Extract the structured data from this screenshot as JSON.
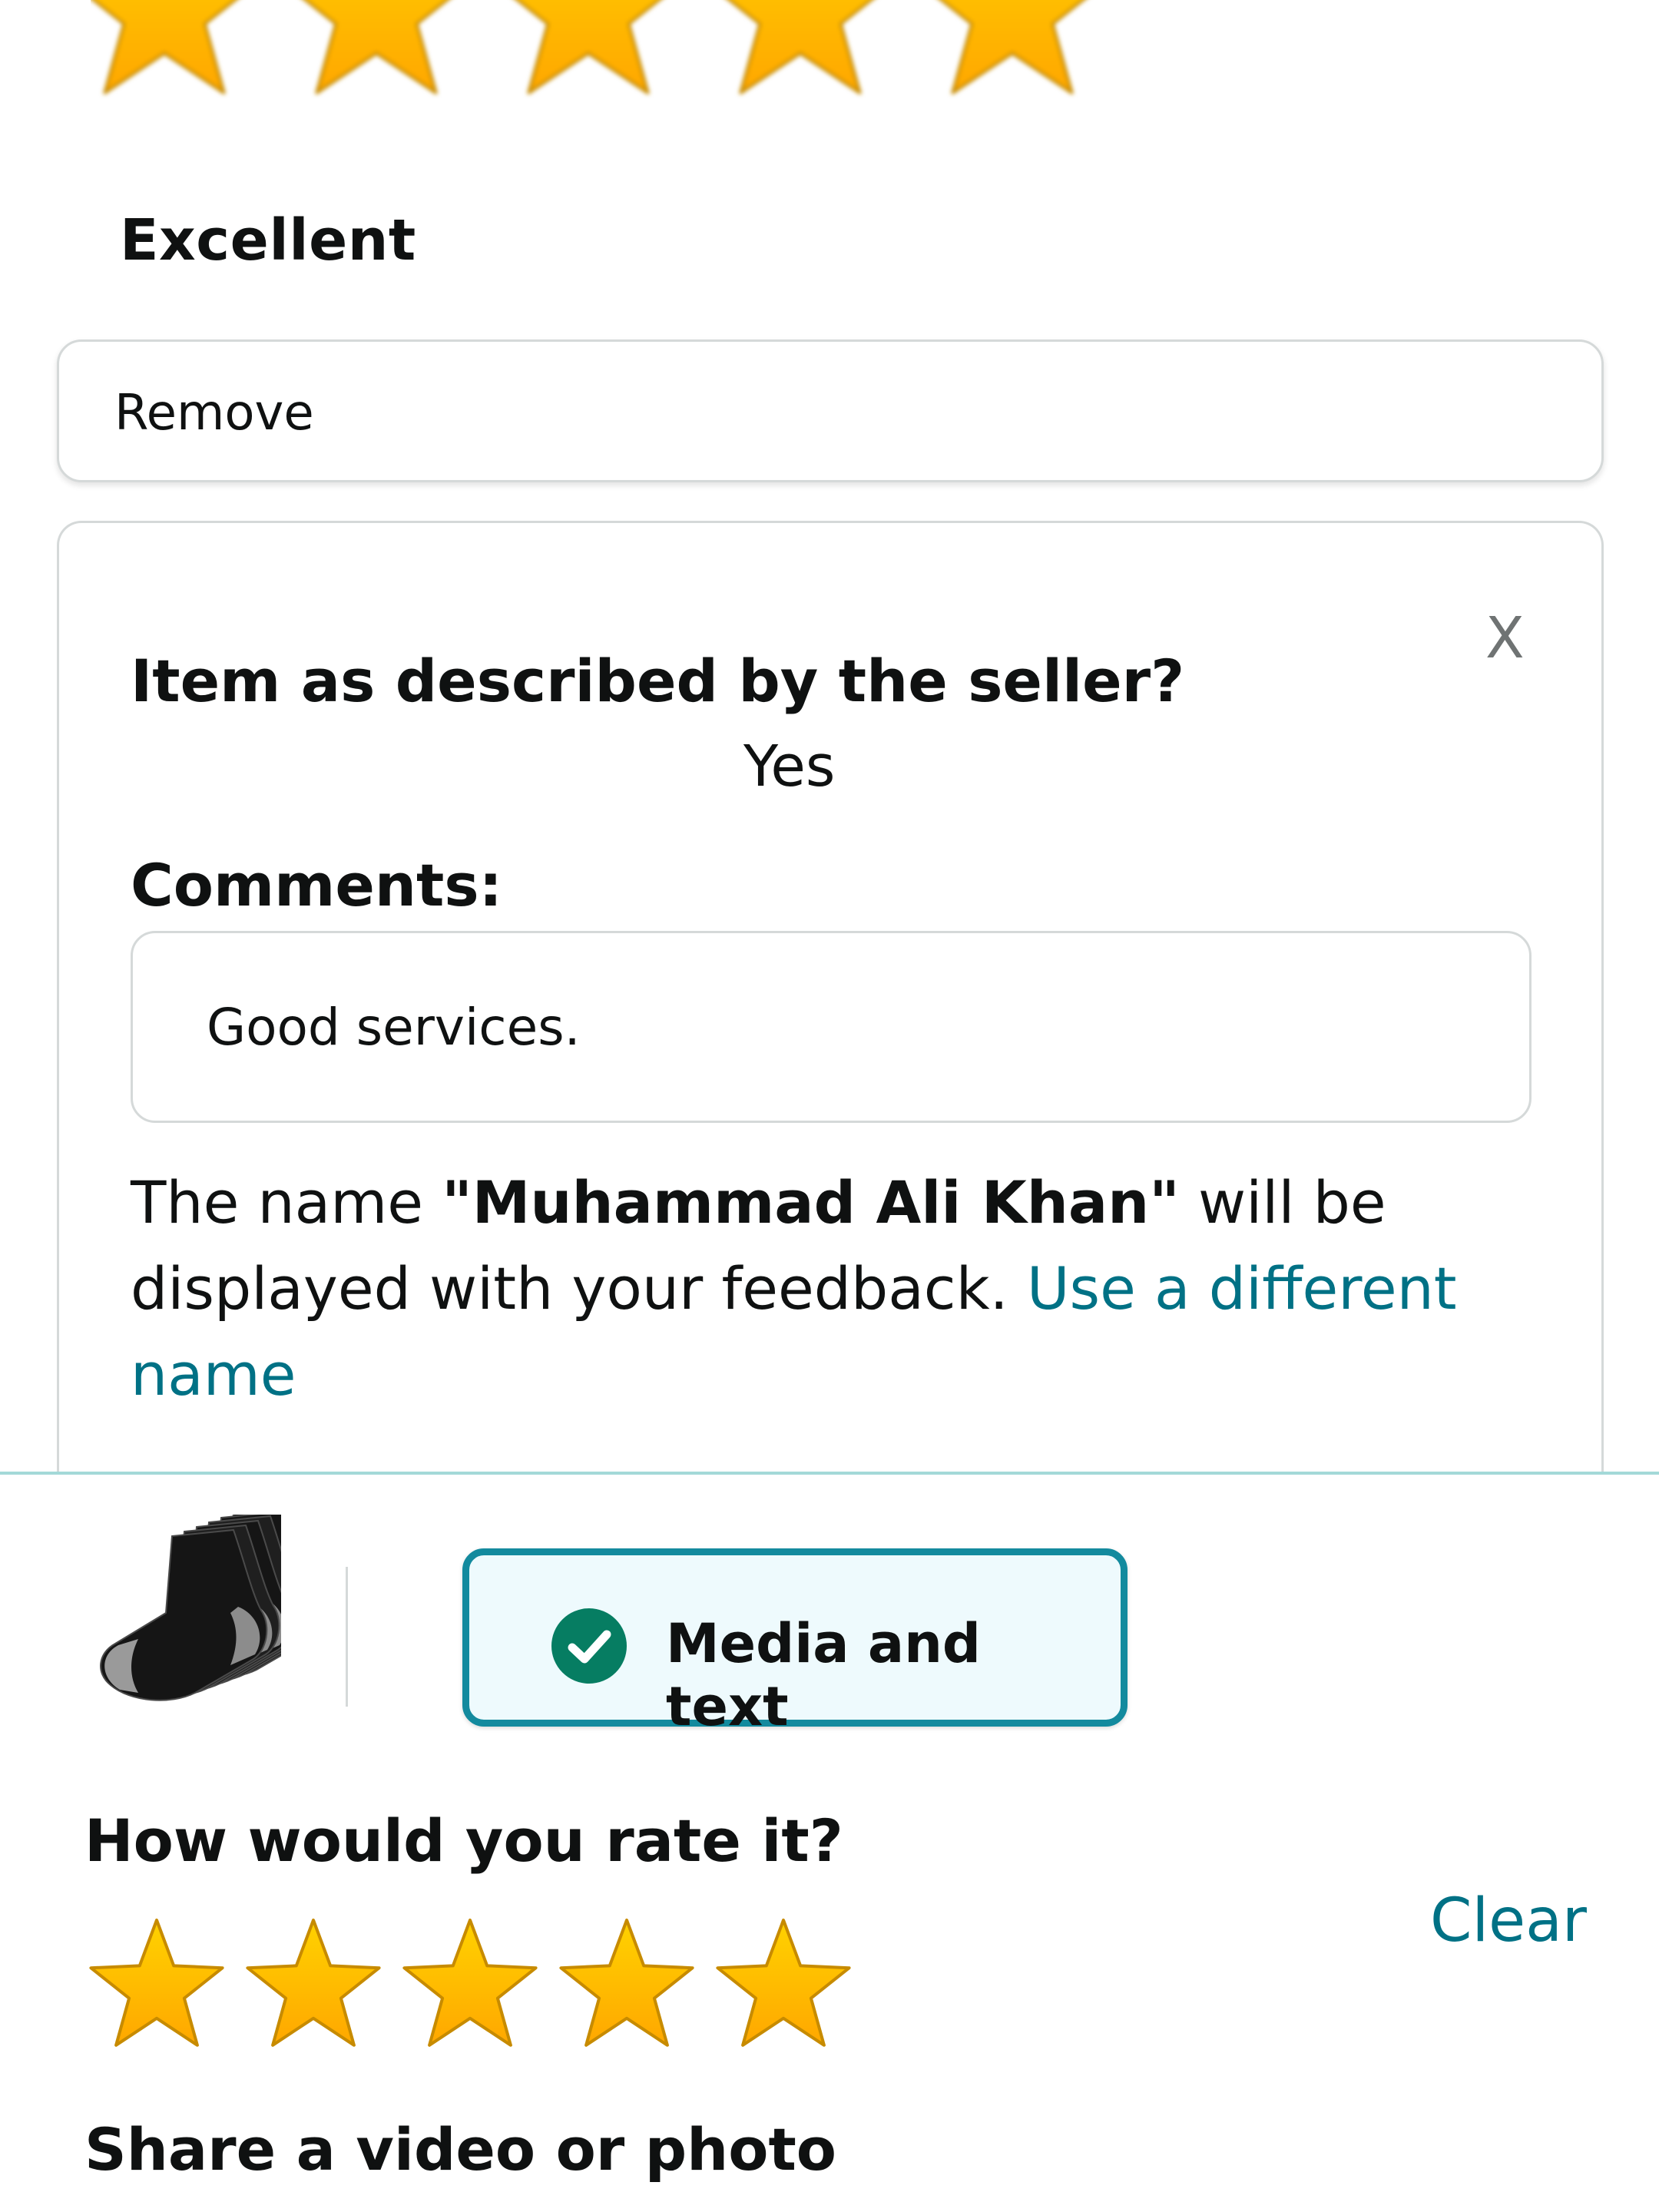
{
  "colors": {
    "star_fill_top": "#ffd200",
    "star_fill_bottom": "#ffa700",
    "star_stroke": "#c78b00",
    "link": "#007185",
    "media_button_border": "#138a9e",
    "media_button_bg": "#eefafd",
    "check_circle": "#067d62",
    "divider": "#a3d9d8"
  },
  "seller_feedback": {
    "stars": {
      "filled": 5,
      "max": 5
    },
    "rating_label": "Excellent",
    "remove_label": "Remove",
    "close_label": "X",
    "question": "Item as described by the seller?",
    "answer": "Yes",
    "comments_label": "Comments:",
    "comments_value": "Good services.",
    "name_note": {
      "prefix": "The name ",
      "name": "\"Muhammad Ali Khan\"",
      "suffix": " will be displayed with your feedback. ",
      "link": "Use a different name"
    }
  },
  "product_review": {
    "thumbnail_icon": "socks-product-image",
    "mode_button": {
      "icon": "check-circle-icon",
      "label": "Media and text"
    },
    "rate_question": "How would you rate it?",
    "clear_label": "Clear",
    "stars": {
      "filled": 5,
      "max": 5
    },
    "share_title": "Share a video or photo"
  }
}
